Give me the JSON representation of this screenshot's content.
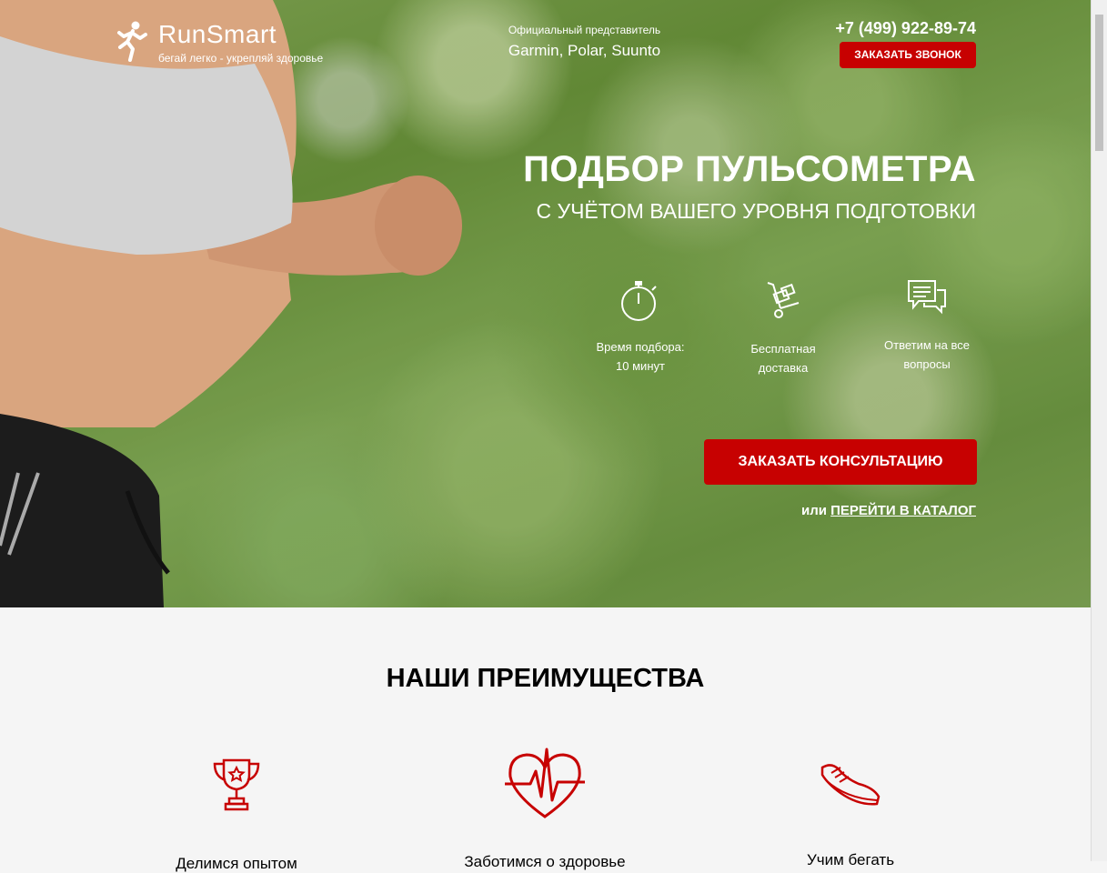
{
  "header": {
    "logo_title": "RunSmart",
    "logo_slogan": "бегай легко - укрепляй здоровье",
    "dealer_subtitle": "Официальный представитель",
    "dealer_brands": "Garmin, Polar, Suunto",
    "phone": "+7 (499) 922-89-74",
    "callback_label": "ЗАКАЗАТЬ ЗВОНОК"
  },
  "hero": {
    "title": "ПОДБОР ПУЛЬСОМЕТРА",
    "subtitle": "С УЧЁТОМ ВАШЕГО УРОВНЯ ПОДГОТОВКИ",
    "features": [
      {
        "icon": "stopwatch-icon",
        "line1": "Время подбора:",
        "line2": "10 минут"
      },
      {
        "icon": "delivery-cart-icon",
        "line1": "Бесплатная",
        "line2": "доставка"
      },
      {
        "icon": "chat-bubbles-icon",
        "line1": "Ответим на все",
        "line2": "вопросы"
      }
    ],
    "consult_label": "ЗАКАЗАТЬ КОНСУЛЬТАЦИЮ",
    "catalog_prefix": "или",
    "catalog_link": "ПЕРЕЙТИ В КАТАЛОГ"
  },
  "advantages": {
    "title": "НАШИ ПРЕИМУЩЕСТВА",
    "items": [
      {
        "icon": "trophy-icon",
        "label": "Делимся опытом"
      },
      {
        "icon": "heart-pulse-icon",
        "label": "Заботимся о здоровье"
      },
      {
        "icon": "sneaker-icon",
        "label": "Учим бегать"
      }
    ]
  },
  "colors": {
    "accent": "#c70101",
    "hero_text": "#ffffff",
    "section_bg": "#f5f5f5"
  }
}
